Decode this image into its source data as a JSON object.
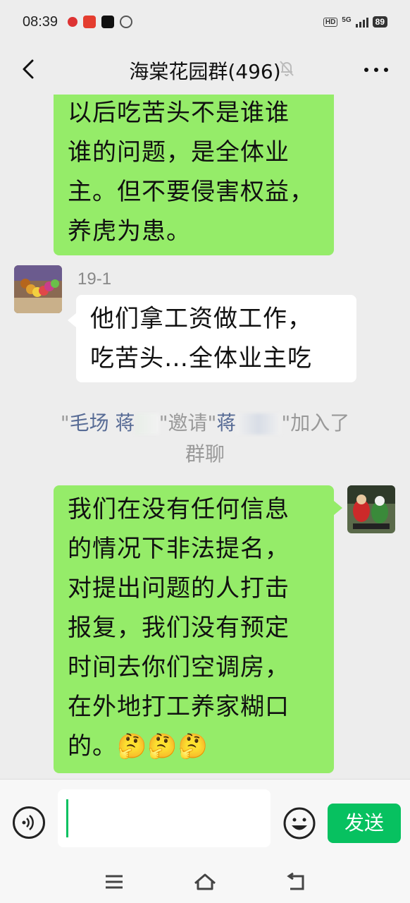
{
  "status_bar": {
    "time": "08:39",
    "network": "5G",
    "battery": "89",
    "hd": "HD"
  },
  "header": {
    "title": "海棠花园群(496)",
    "back_icon": "chevron-left-icon",
    "mute_icon": "bell-off-icon",
    "more_icon": "more-dots-icon"
  },
  "messages": [
    {
      "type": "outgoing",
      "lines": [
        "以后吃苦头不是谁谁",
        "谁的问题，是全体业",
        "主。但不要侵害权益，",
        "养虎为患。"
      ]
    },
    {
      "type": "incoming",
      "sender": "19-1",
      "lines": [
        "他们拿工资做工作，",
        "吃苦头…全体业主吃"
      ]
    },
    {
      "type": "system",
      "q1": "\"",
      "name1": "毛场 蒋",
      "mid": "\"邀请\"",
      "name2": "蒋",
      "tail": "\"加入了",
      "line2": "群聊"
    },
    {
      "type": "outgoing",
      "lines": [
        "我们在没有任何信息",
        "的情况下非法提名，",
        "对提出问题的人打击",
        "报复，我们没有预定",
        "时间去你们空调房，",
        "在外地打工养家糊口",
        "的。🤔🤔🤔"
      ]
    }
  ],
  "input": {
    "value": "",
    "send_label": "发送",
    "voice_icon": "voice-icon",
    "emoji_icon": "emoji-icon"
  },
  "colors": {
    "outgoing_bubble": "#95ec69",
    "incoming_bubble": "#ffffff",
    "accent": "#07c160",
    "system_name": "#576b95"
  }
}
